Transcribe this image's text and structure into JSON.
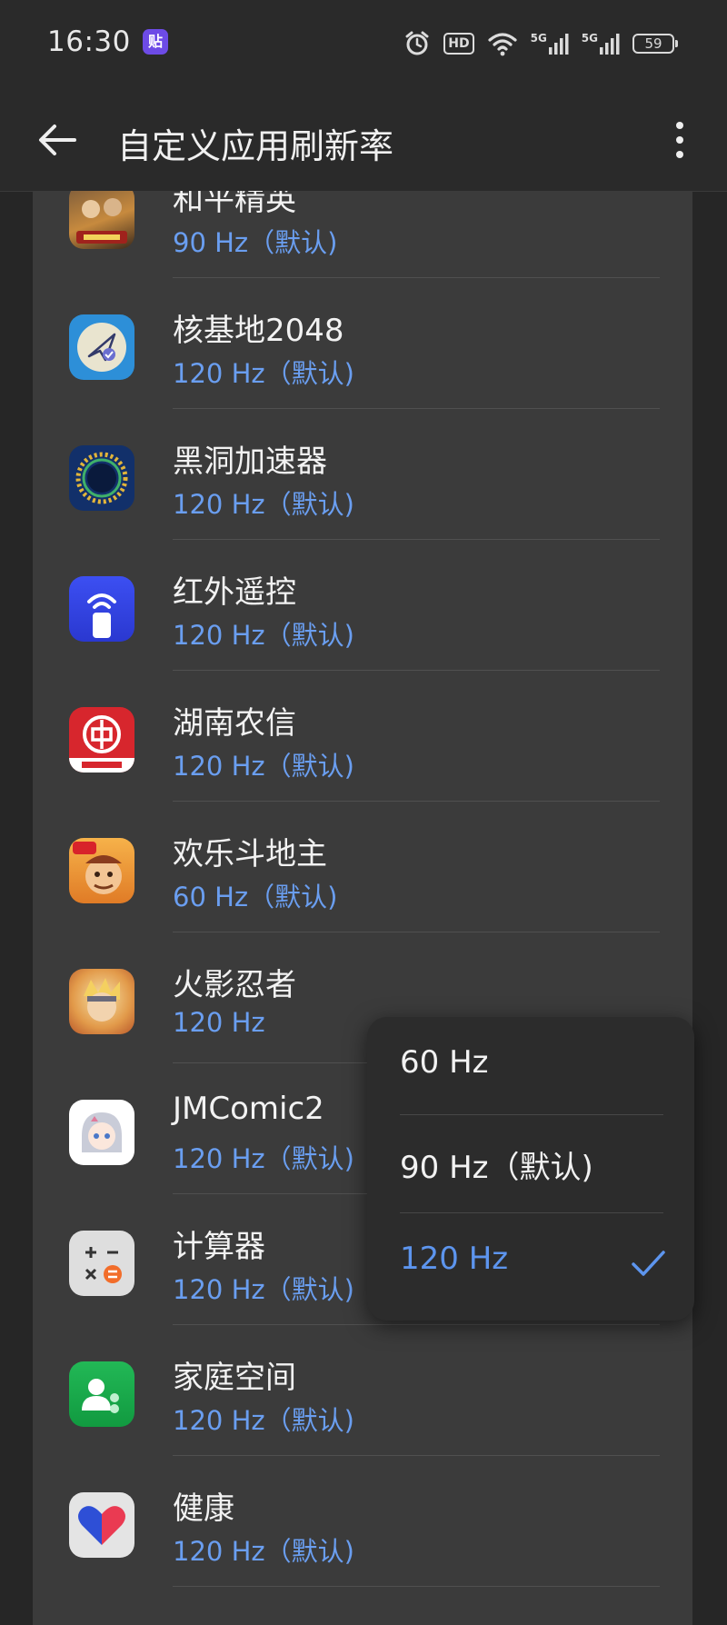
{
  "status_bar": {
    "time": "16:30",
    "notification_badge": "贴",
    "battery": "59",
    "network_label_1": "5G",
    "network_label_2": "5G",
    "hd_label": "HD"
  },
  "app_bar": {
    "title": "自定义应用刷新率",
    "back_icon": "arrow-left-icon",
    "more_icon": "more-vertical-icon"
  },
  "apps": [
    {
      "name": "和平精英",
      "rate": "90 Hz（默认)",
      "icon": "game-soldiers-icon",
      "icon_color": "#c9843a"
    },
    {
      "name": "核基地2048",
      "rate": "120 Hz（默认)",
      "icon": "paper-plane-check-icon",
      "icon_color": "#2d8fd8"
    },
    {
      "name": "黑洞加速器",
      "rate": "120 Hz（默认)",
      "icon": "black-hole-icon",
      "icon_color": "#1a3a7a"
    },
    {
      "name": "红外遥控",
      "rate": "120 Hz（默认)",
      "icon": "remote-signal-icon",
      "icon_color": "#3b4cf0"
    },
    {
      "name": "湖南农信",
      "rate": "120 Hz（默认)",
      "icon": "bank-coin-icon",
      "icon_color": "#d7262d"
    },
    {
      "name": "欢乐斗地主",
      "rate": "60 Hz（默认)",
      "icon": "landlord-character-icon",
      "icon_color": "#f0a53a"
    },
    {
      "name": "火影忍者",
      "rate": "120 Hz",
      "icon": "ninja-character-icon",
      "icon_color": "#e8a550"
    },
    {
      "name": "JMComic2",
      "rate": "120 Hz（默认)",
      "icon": "anime-girl-icon",
      "icon_color": "#ffffff"
    },
    {
      "name": "计算器",
      "rate": "120 Hz（默认)",
      "icon": "calculator-icon",
      "icon_color": "#dedede"
    },
    {
      "name": "家庭空间",
      "rate": "120 Hz（默认)",
      "icon": "family-people-icon",
      "icon_color": "#19a84a"
    },
    {
      "name": "健康",
      "rate": "120 Hz（默认)",
      "icon": "heart-icon",
      "icon_color": "#e4e4e4"
    }
  ],
  "rate_menu": {
    "options": [
      {
        "label": "60 Hz",
        "selected": false
      },
      {
        "label": "90 Hz（默认)",
        "selected": false
      },
      {
        "label": "120 Hz",
        "selected": true
      }
    ],
    "check_icon": "checkmark-icon"
  },
  "colors": {
    "background": "#262626",
    "card": "#3b3b3b",
    "accent_blue": "#6a9ef0",
    "menu_background": "#2c2c2c"
  }
}
